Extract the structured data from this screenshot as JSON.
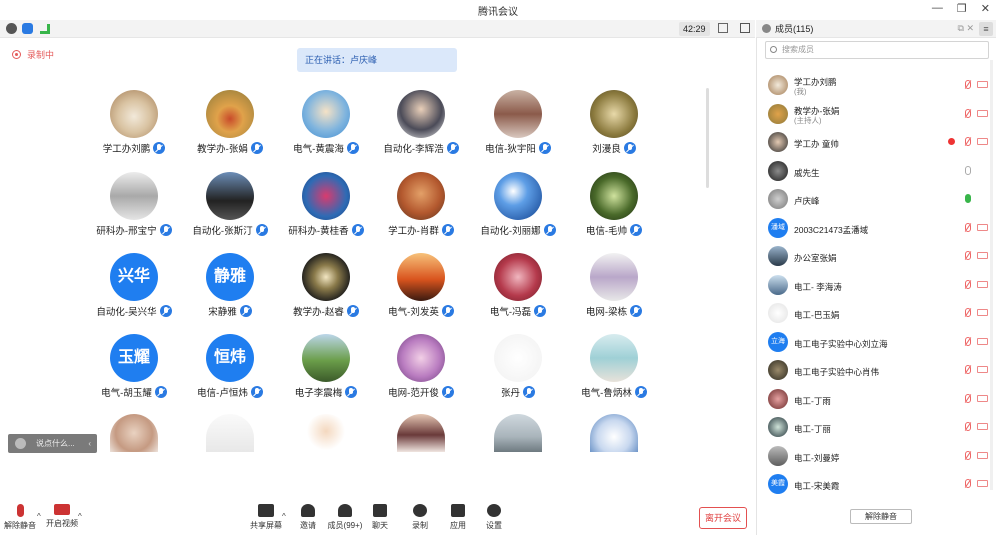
{
  "window": {
    "title": "腾讯会议",
    "timer": "42:29"
  },
  "status": {
    "recording": "录制中",
    "speaking": "正在讲话：卢庆峰"
  },
  "tiles": [
    {
      "name": "学工办刘鹏",
      "type": "img",
      "bg": "radial-gradient(circle at 50% 55%, #f2e9da 0%, #d9c3a2 45%, #a37c54 100%)"
    },
    {
      "name": "教学办-张娟",
      "type": "img",
      "bg": "radial-gradient(circle at 50% 60%, #c94b2a 0%, #e0a24a 35%, #8e7a3a 100%)"
    },
    {
      "name": "电气-黄震海",
      "type": "img",
      "bg": "radial-gradient(circle at 50% 45%, #f5e2c6 0%, #7fb4de 55%, #3e8bd1 100%)"
    },
    {
      "name": "自动化-李辉浩",
      "type": "img",
      "bg": "radial-gradient(circle at 50% 40%, #e9cfb9 0%, #4b4b58 55%, #efefef 100%)"
    },
    {
      "name": "电信-狄宇阳",
      "type": "img",
      "bg": "linear-gradient(180deg, #c9b2a4 0%, #8b5a4a 50%, #d9c8bf 100%)"
    },
    {
      "name": "刘漫良",
      "type": "img",
      "bg": "radial-gradient(circle at 50% 50%, #e8d9a9 0%, #8b7a3e 60%, #4e4420 100%)"
    },
    {
      "name": "研科办-邢宝宁",
      "type": "img",
      "bg": "linear-gradient(180deg, #ececec 0%, #a9a9a9 50%, #e5e5e5 100%)"
    },
    {
      "name": "自动化-张斯汀",
      "type": "img",
      "bg": "linear-gradient(180deg, #6c8eb8 0%, #222 60%, #555 100%)"
    },
    {
      "name": "研科办-黄桂香",
      "type": "img",
      "bg": "radial-gradient(circle at 50% 50%, #d93b6e 0%, #2e6bb5 60%, #1b3e7a 100%)"
    },
    {
      "name": "学工办-肖群",
      "type": "img",
      "bg": "radial-gradient(circle at 50% 45%, #e3a068 0%, #b3582e 55%, #5a3420 100%)"
    },
    {
      "name": "自动化-刘丽娜",
      "type": "img",
      "bg": "radial-gradient(circle at 40% 40%, #ffffff 0%, #5e9ee6 35%, #0f3e8c 100%)"
    },
    {
      "name": "电信-毛帅",
      "type": "img",
      "bg": "radial-gradient(circle at 50% 50%, #cfe29e 0%, #4a6a2a 55%, #1b2a10 100%)"
    },
    {
      "name": "自动化-吴兴华",
      "type": "text",
      "text": "兴华"
    },
    {
      "name": "宋静雅",
      "type": "text",
      "text": "静雅"
    },
    {
      "name": "教学办-赵睿",
      "type": "img",
      "bg": "radial-gradient(circle at 50% 50%, #f2e6c2 0%, #8a7a4a 35%, #1a1a1a 75%)"
    },
    {
      "name": "电气-刘发英",
      "type": "img",
      "bg": "linear-gradient(180deg, #f7c27a 0%, #d9541e 55%, #3a1a10 100%)"
    },
    {
      "name": "电气-冯磊",
      "type": "img",
      "bg": "radial-gradient(circle at 50% 50%, #f0b6bf 0%, #b53a4c 55%, #6a1a24 100%)"
    },
    {
      "name": "电网-梁栋",
      "type": "img",
      "bg": "linear-gradient(180deg, #f2f2f2 0%, #b9a7c9 50%, #e8e8e8 100%)"
    },
    {
      "name": "电气-胡玉耀",
      "type": "text",
      "text": "玉耀"
    },
    {
      "name": "电信-卢恒炜",
      "type": "text",
      "text": "恒炜"
    },
    {
      "name": "电子李震梅",
      "type": "img",
      "bg": "linear-gradient(180deg, #bcd6ea 0%, #6b9e4a 55%, #3b5a2a 100%)"
    },
    {
      "name": "电网-范开俊",
      "type": "img",
      "bg": "radial-gradient(circle at 50% 50%, #f2cfe6 0%, #b97cc0 55%, #6a3a7a 100%)"
    },
    {
      "name": "张丹",
      "type": "img",
      "bg": "radial-gradient(circle at 50% 50%, #ffffff 0%, #f5f5f5 70%, #e6e6e6 100%)"
    },
    {
      "name": "电气-鲁炳林",
      "type": "img",
      "bg": "linear-gradient(180deg, #d8ecef 0%, #9fd0d6 50%, #e8e2da 100%)"
    },
    {
      "name": "",
      "type": "img",
      "bg": "radial-gradient(circle at 50% 50%, #e9d2c1 0%, #c59a82 60%, #ede3dc 100%)"
    },
    {
      "name": "",
      "type": "img",
      "bg": "linear-gradient(180deg, #fafafa 0%, #e8e8e8 100%)"
    },
    {
      "name": "",
      "type": "img",
      "bg": "radial-gradient(circle at 50% 45%, #f4d8bf 0%, #ffffff 60%)"
    },
    {
      "name": "",
      "type": "img",
      "bg": "linear-gradient(180deg, #e5c7b4 0%, #6a3a3a 55%, #f0e5e0 100%)"
    },
    {
      "name": "",
      "type": "img",
      "bg": "linear-gradient(180deg, #cfd8de 0%, #a9b4bb 60%, #6e7a80 100%)"
    },
    {
      "name": "",
      "type": "img",
      "bg": "radial-gradient(circle at 50% 60%, #ffffff 0%, #c8d8ef 50%, #4a7ab8 100%)"
    }
  ],
  "chat": {
    "placeholder": "说点什么..."
  },
  "toolbar": {
    "mute": "解除静音",
    "video": "开启视频",
    "share": "共享屏幕",
    "invite": "邀请",
    "members": "成员(99+)",
    "chat": "聊天",
    "record": "录制",
    "apps": "应用",
    "settings": "设置",
    "leave": "离开会议"
  },
  "members_panel": {
    "header": "成员(115)",
    "search_placeholder": "搜索成员",
    "unmute_all": "解除静音",
    "members": [
      {
        "name": "学工办刘鹏",
        "sub": "(我)",
        "bg": "radial-gradient(circle, #f2e9da 0%, #a37c54 100%)",
        "mic": "muted",
        "rec": false
      },
      {
        "name": "教学办-张娟",
        "sub": "(主持人)",
        "bg": "radial-gradient(circle, #e0a24a 0%, #8e7a3a 100%)",
        "mic": "muted",
        "rec": false
      },
      {
        "name": "学工办 童帅",
        "sub": "",
        "bg": "radial-gradient(circle, #e3c9b2 0%, #2d2d2d 100%)",
        "mic": "muted",
        "rec": true
      },
      {
        "name": "戚先生",
        "sub": "",
        "bg": "radial-gradient(circle, #8b8b8b 0%, #1c1c1c 100%)",
        "mic": "on",
        "rec": false
      },
      {
        "name": "卢庆峰",
        "sub": "",
        "bg": "radial-gradient(circle, #cfcfcf 0%, #777 100%)",
        "mic": "green",
        "rec": false
      },
      {
        "name": "2003C21473孟潘域",
        "sub": "",
        "text": "潘域",
        "mic": "muted",
        "rec": false
      },
      {
        "name": "办公室张娟",
        "sub": "",
        "bg": "linear-gradient(180deg, #9ab4cc 0%, #2a3a4a 100%)",
        "mic": "muted",
        "rec": false
      },
      {
        "name": "电工- 李海涛",
        "sub": "",
        "bg": "linear-gradient(180deg, #cde0ef 0%, #4a6a8a 100%)",
        "mic": "muted",
        "rec": false
      },
      {
        "name": "电工-巴玉娟",
        "sub": "",
        "bg": "radial-gradient(circle, #ffffff 0%, #e2e2e2 100%)",
        "mic": "muted",
        "rec": false
      },
      {
        "name": "电工电子实验中心刘立海",
        "sub": "",
        "text": "立海",
        "mic": "muted",
        "rec": false
      },
      {
        "name": "电工电子实验中心肖伟",
        "sub": "",
        "bg": "radial-gradient(circle, #9a8a6a 0%, #2d2a20 100%)",
        "mic": "muted",
        "rec": false
      },
      {
        "name": "电工-丁雨",
        "sub": "",
        "bg": "radial-gradient(circle, #e6a1a1 0%, #6a2a2a 100%)",
        "mic": "muted",
        "rec": false
      },
      {
        "name": "电工-丁丽",
        "sub": "",
        "bg": "radial-gradient(circle, #cfe3d9 0%, #23343a 100%)",
        "mic": "muted",
        "rec": false
      },
      {
        "name": "电工-刘曼婷",
        "sub": "",
        "bg": "linear-gradient(180deg, #bcbcbc 0%, #5e5e5e 100%)",
        "mic": "muted",
        "rec": false
      },
      {
        "name": "电工-宋美霞",
        "sub": "",
        "text": "美霞",
        "mic": "muted",
        "rec": false
      }
    ]
  }
}
